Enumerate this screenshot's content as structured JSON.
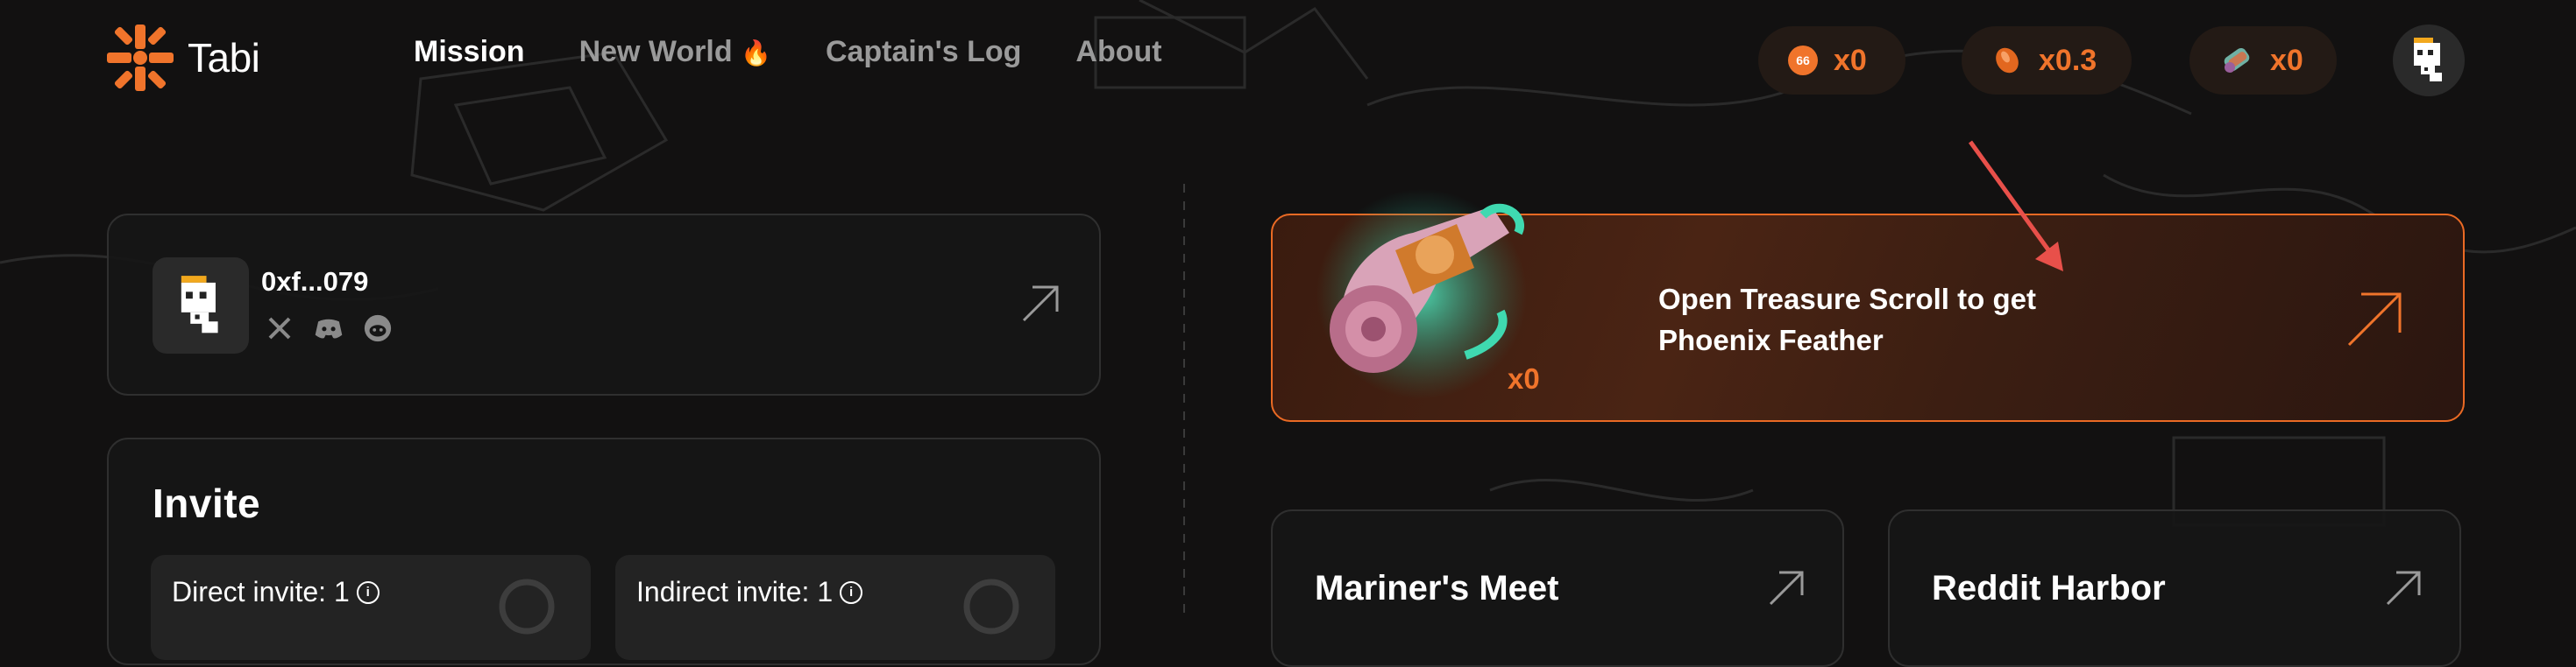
{
  "header": {
    "logo_text": "Tabi",
    "nav": [
      {
        "label": "Mission",
        "active": true
      },
      {
        "label": "New World",
        "suffix_icon": "fire-icon",
        "emoji": "🔥"
      },
      {
        "label": "Captain's Log"
      },
      {
        "label": "About"
      }
    ],
    "counters": [
      {
        "icon": "tabi-coin-icon",
        "coin_text": "66",
        "value": "x0"
      },
      {
        "icon": "bean-coin-icon",
        "value": "x0.3"
      },
      {
        "icon": "scroll-bundle-icon",
        "value": "x0"
      }
    ]
  },
  "profile": {
    "address": "0xf...079",
    "socials": [
      "x-icon",
      "discord-icon",
      "reddit-icon"
    ]
  },
  "invite": {
    "title": "Invite",
    "direct_label": "Direct invite: 1",
    "indirect_label": "Indirect invite: 1"
  },
  "scroll_promo": {
    "count": "x0",
    "text": "Open Treasure Scroll to get Phoenix Feather"
  },
  "missions": [
    {
      "title": "Mariner's Meet"
    },
    {
      "title": "Reddit Harbor"
    }
  ],
  "colors": {
    "accent": "#f0742b",
    "background": "#121111",
    "card_border": "#2f2f2f",
    "annotation_arrow": "#e8504a"
  }
}
